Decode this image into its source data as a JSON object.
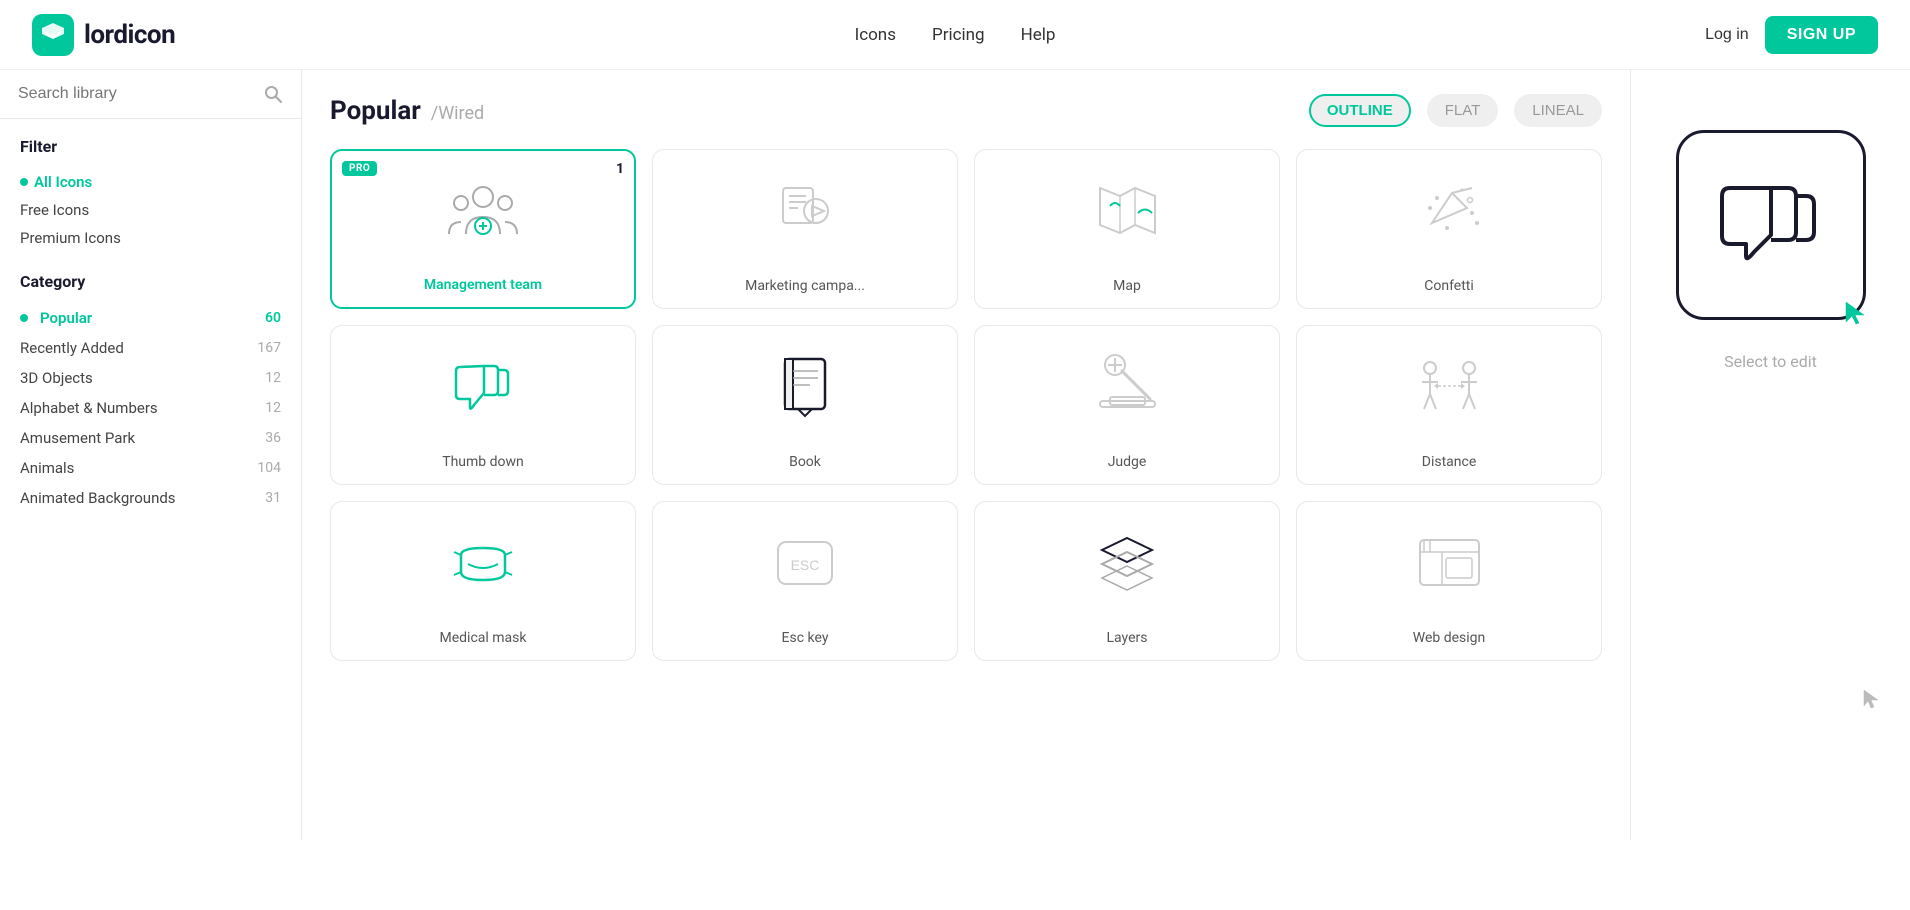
{
  "header": {
    "logo_text": "lordicon",
    "nav": {
      "icons_label": "Icons",
      "pricing_label": "Pricing",
      "help_label": "Help"
    },
    "login_label": "Log in",
    "signup_label": "SIGN UP"
  },
  "sidebar": {
    "search_placeholder": "Search library",
    "filter": {
      "title": "Filter",
      "items": [
        {
          "label": "All Icons",
          "active": true
        },
        {
          "label": "Free Icons",
          "active": false
        },
        {
          "label": "Premium Icons",
          "active": false
        }
      ]
    },
    "category": {
      "title": "Category",
      "items": [
        {
          "label": "Popular",
          "count": 60,
          "active": true
        },
        {
          "label": "Recently Added",
          "count": 167,
          "active": false
        },
        {
          "label": "3D Objects",
          "count": 12,
          "active": false
        },
        {
          "label": "Alphabet & Numbers",
          "count": 12,
          "active": false
        },
        {
          "label": "Amusement Park",
          "count": 36,
          "active": false
        },
        {
          "label": "Animals",
          "count": 104,
          "active": false
        },
        {
          "label": "Animated Backgrounds",
          "count": 31,
          "active": false
        }
      ]
    }
  },
  "main": {
    "title": "Popular",
    "subtitle": "/Wired",
    "view_tabs": [
      {
        "label": "OUTLINE",
        "active": true
      },
      {
        "label": "FLAT",
        "active": false
      },
      {
        "label": "LINEAL",
        "active": false
      }
    ],
    "icons": [
      {
        "id": 1,
        "label": "Management team",
        "pro": true,
        "pro_num": 1,
        "selected": false
      },
      {
        "id": 2,
        "label": "Marketing campa...",
        "pro": false,
        "selected": false
      },
      {
        "id": 3,
        "label": "Map",
        "pro": false,
        "selected": false
      },
      {
        "id": 4,
        "label": "Confetti",
        "pro": false,
        "selected": false
      },
      {
        "id": 5,
        "label": "Thumb down",
        "pro": false,
        "selected": false
      },
      {
        "id": 6,
        "label": "Book",
        "pro": false,
        "selected": false
      },
      {
        "id": 7,
        "label": "Judge",
        "pro": false,
        "selected": false
      },
      {
        "id": 8,
        "label": "Distance",
        "pro": false,
        "selected": false
      },
      {
        "id": 9,
        "label": "Medical mask",
        "pro": false,
        "selected": false
      },
      {
        "id": 10,
        "label": "Esc key",
        "pro": false,
        "selected": false
      },
      {
        "id": 11,
        "label": "Layers",
        "pro": false,
        "selected": false
      },
      {
        "id": 12,
        "label": "Web design",
        "pro": false,
        "selected": false
      }
    ]
  },
  "right_panel": {
    "select_label": "Select to edit"
  }
}
